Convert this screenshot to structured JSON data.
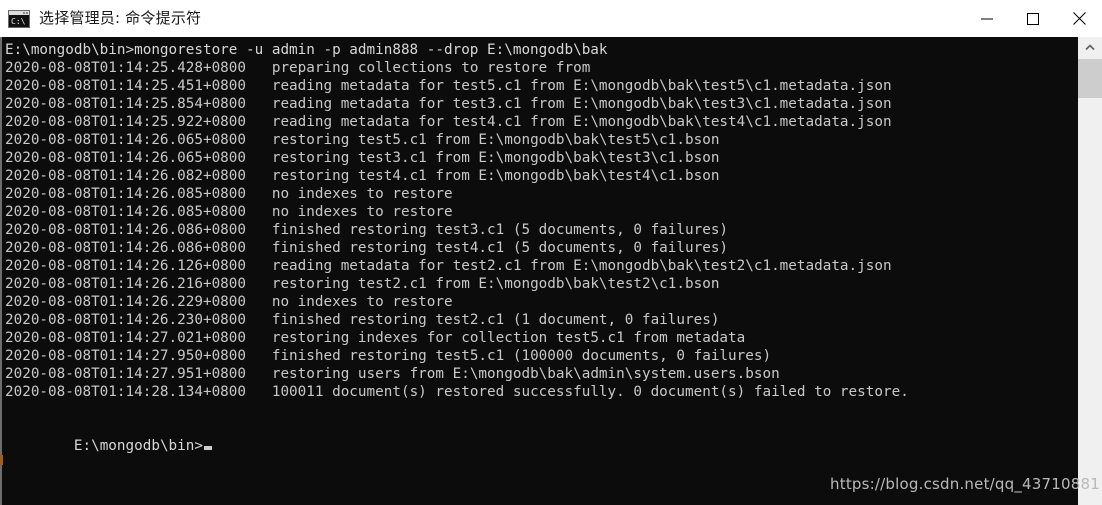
{
  "window": {
    "title": "选择管理员: 命令提示符",
    "icon": "cmd-console-icon",
    "background": "#0c0c0c",
    "foreground": "#cccccc",
    "controls": [
      {
        "name": "minimize",
        "glyph": "—"
      },
      {
        "name": "maximize",
        "glyph": "☐"
      },
      {
        "name": "close",
        "glyph": "✕"
      }
    ]
  },
  "terminal": {
    "command_line": "E:\\mongodb\\bin>mongorestore -u admin -p admin888 --drop E:\\mongodb\\bak",
    "lines": [
      {
        "ts": "2020-08-08T01:14:25.428+0800",
        "msg": "preparing collections to restore from"
      },
      {
        "ts": "2020-08-08T01:14:25.451+0800",
        "msg": "reading metadata for test5.c1 from E:\\mongodb\\bak\\test5\\c1.metadata.json"
      },
      {
        "ts": "2020-08-08T01:14:25.854+0800",
        "msg": "reading metadata for test3.c1 from E:\\mongodb\\bak\\test3\\c1.metadata.json"
      },
      {
        "ts": "2020-08-08T01:14:25.922+0800",
        "msg": "reading metadata for test4.c1 from E:\\mongodb\\bak\\test4\\c1.metadata.json"
      },
      {
        "ts": "2020-08-08T01:14:26.065+0800",
        "msg": "restoring test5.c1 from E:\\mongodb\\bak\\test5\\c1.bson"
      },
      {
        "ts": "2020-08-08T01:14:26.065+0800",
        "msg": "restoring test3.c1 from E:\\mongodb\\bak\\test3\\c1.bson"
      },
      {
        "ts": "2020-08-08T01:14:26.082+0800",
        "msg": "restoring test4.c1 from E:\\mongodb\\bak\\test4\\c1.bson"
      },
      {
        "ts": "2020-08-08T01:14:26.085+0800",
        "msg": "no indexes to restore"
      },
      {
        "ts": "2020-08-08T01:14:26.085+0800",
        "msg": "no indexes to restore"
      },
      {
        "ts": "2020-08-08T01:14:26.086+0800",
        "msg": "finished restoring test3.c1 (5 documents, 0 failures)"
      },
      {
        "ts": "2020-08-08T01:14:26.086+0800",
        "msg": "finished restoring test4.c1 (5 documents, 0 failures)"
      },
      {
        "ts": "2020-08-08T01:14:26.126+0800",
        "msg": "reading metadata for test2.c1 from E:\\mongodb\\bak\\test2\\c1.metadata.json"
      },
      {
        "ts": "2020-08-08T01:14:26.216+0800",
        "msg": "restoring test2.c1 from E:\\mongodb\\bak\\test2\\c1.bson"
      },
      {
        "ts": "2020-08-08T01:14:26.229+0800",
        "msg": "no indexes to restore"
      },
      {
        "ts": "2020-08-08T01:14:26.230+0800",
        "msg": "finished restoring test2.c1 (1 document, 0 failures)"
      },
      {
        "ts": "2020-08-08T01:14:27.021+0800",
        "msg": "restoring indexes for collection test5.c1 from metadata"
      },
      {
        "ts": "2020-08-08T01:14:27.950+0800",
        "msg": "finished restoring test5.c1 (100000 documents, 0 failures)"
      },
      {
        "ts": "2020-08-08T01:14:27.951+0800",
        "msg": "restoring users from E:\\mongodb\\bak\\admin\\system.users.bson"
      },
      {
        "ts": "2020-08-08T01:14:28.134+0800",
        "msg": "100011 document(s) restored successfully. 0 document(s) failed to restore."
      }
    ],
    "prompt": "E:\\mongodb\\bin>"
  },
  "scrollbar": {
    "up_arrow": "scroll-up-arrow"
  },
  "watermark": {
    "text": "https://blog.csdn.net/qq_43710881"
  }
}
